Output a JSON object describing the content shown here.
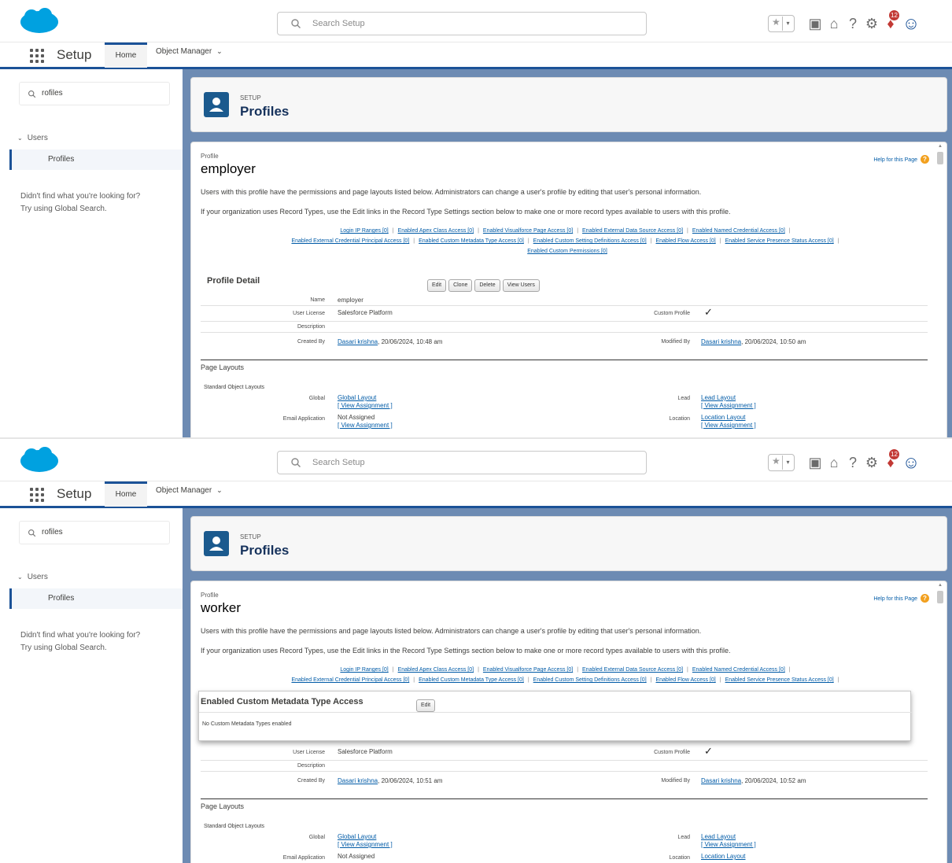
{
  "header": {
    "search_placeholder": "Search Setup",
    "badge_count": "12",
    "icons": [
      "star-icon",
      "add-icon",
      "trailhead-icon",
      "help-icon",
      "gear-icon",
      "bell-icon",
      "avatar-icon"
    ]
  },
  "appbar": {
    "title": "Setup",
    "tab_home": "Home",
    "tab_object_manager": "Object Manager"
  },
  "sidebar": {
    "quickfind_value": "rofiles",
    "tree_parent": "Users",
    "tree_child": "Profiles",
    "hint_line1": "Didn't find what you're looking for?",
    "hint_line2": "Try using Global Search."
  },
  "page_header": {
    "kicker": "SETUP",
    "title": "Profiles"
  },
  "shots": [
    {
      "kicker": "Profile",
      "profile_name": "employer",
      "help_link": "Help for this Page",
      "desc1": "Users with this profile have the permissions and page layouts listed below. Administrators can change a user's profile by editing that user's personal information.",
      "desc2": "If your organization uses Record Types, use the Edit links in the Record Type Settings section below to make one or more record types available to users with this profile.",
      "links": [
        "Login IP Ranges [0]",
        "Enabled Apex Class Access [0]",
        "Enabled Visualforce Page Access [0]",
        "Enabled External Data Source Access [0]",
        "Enabled Named Credential Access [0]",
        "Enabled External Credential Principal Access [0]",
        "Enabled Custom Metadata Type Access [0]",
        "Enabled Custom Setting Definitions Access [0]",
        "Enabled Flow Access [0]",
        "Enabled Service Presence Status Access [0]",
        "Enabled Custom Permissions [0]"
      ],
      "detail_title": "Profile Detail",
      "buttons": [
        "Edit",
        "Clone",
        "Delete",
        "View Users"
      ],
      "name_label": "Name",
      "name_value": "employer",
      "license_label": "User License",
      "license_value": "Salesforce Platform",
      "custom_label": "Custom Profile",
      "custom_value": "✓",
      "description_label": "Description",
      "created_label": "Created By",
      "created_user": "Dasari krishna",
      "created_date": ", 20/06/2024, 10:48 am",
      "modified_label": "Modified By",
      "modified_user": "Dasari krishna",
      "modified_date": ", 20/06/2024, 10:50 am",
      "layouts_title": "Page Layouts",
      "std_layouts": "Standard Object Layouts",
      "global_label": "Global",
      "global_link": "Global Layout",
      "view_assignment": "[ View Assignment ]",
      "lead_label": "Lead",
      "lead_link": "Lead Layout",
      "email_label": "Email Application",
      "email_value": "Not Assigned",
      "location_label": "Location",
      "location_link": "Location Layout"
    },
    {
      "kicker": "Profile",
      "profile_name": "worker",
      "help_link": "Help for this Page",
      "desc1": "Users with this profile have the permissions and page layouts listed below. Administrators can change a user's profile by editing that user's personal information.",
      "desc2": "If your organization uses Record Types, use the Edit links in the Record Type Settings section below to make one or more record types available to users with this profile.",
      "links": [
        "Login IP Ranges [0]",
        "Enabled Apex Class Access [0]",
        "Enabled Visualforce Page Access [0]",
        "Enabled External Data Source Access [0]",
        "Enabled Named Credential Access [0]",
        "Enabled External Credential Principal Access [0]",
        "Enabled Custom Metadata Type Access [0]",
        "Enabled Custom Setting Definitions Access [0]",
        "Enabled Flow Access [0]",
        "Enabled Service Presence Status Access [0]"
      ],
      "overlay_title": "Enabled Custom Metadata Type Access",
      "overlay_button": "Edit",
      "overlay_message": "No Custom Metadata Types enabled",
      "license_label": "User License",
      "license_value": "Salesforce Platform",
      "custom_label": "Custom Profile",
      "custom_value": "✓",
      "description_label": "Description",
      "created_label": "Created By",
      "created_user": "Dasari krishna",
      "created_date": ", 20/06/2024, 10:51 am",
      "modified_label": "Modified By",
      "modified_user": "Dasari krishna",
      "modified_date": ", 20/06/2024, 10:52 am",
      "layouts_title": "Page Layouts",
      "std_layouts": "Standard Object Layouts",
      "global_label": "Global",
      "global_link": "Global Layout",
      "view_assignment": "[ View Assignment ]",
      "lead_label": "Lead",
      "lead_link": "Lead Layout",
      "email_label": "Email Application",
      "email_value": "Not Assigned",
      "location_label": "Location",
      "location_link": "Location Layout"
    }
  ],
  "colors": {
    "brand_blue": "#1b5297",
    "cloud": "#00a1e0",
    "link": "#015ba7",
    "header_icon": "#1b5a8e"
  }
}
